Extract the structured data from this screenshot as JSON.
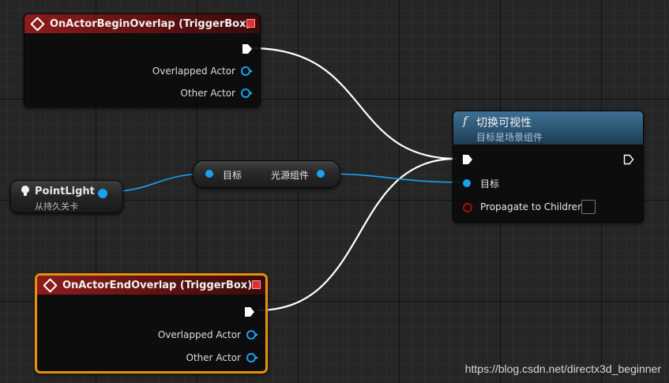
{
  "begin_overlap": {
    "title": "OnActorBeginOverlap (TriggerBox)",
    "pin_overlapped": "Overlapped Actor",
    "pin_other": "Other Actor"
  },
  "end_overlap": {
    "title": "OnActorEndOverlap (TriggerBox)",
    "pin_overlapped": "Overlapped Actor",
    "pin_other": "Other Actor"
  },
  "toggle_visibility": {
    "icon": "f",
    "title": "切换可视性",
    "subtitle": "目标是场景组件",
    "pin_target": "目标",
    "pin_propagate": "Propagate to Children"
  },
  "get_component": {
    "input_label": "目标",
    "output_label": "光源组件"
  },
  "point_light": {
    "title": "PointLight",
    "subtitle": "从持久关卡"
  },
  "watermark": "https://blog.csdn.net/directx3d_beginner",
  "colors": {
    "exec_wire": "#ffffff",
    "object_wire": "#1aa1f0",
    "event_header": "#8e1c1c",
    "function_header": "#3d6f93",
    "selection": "#e7910c"
  }
}
